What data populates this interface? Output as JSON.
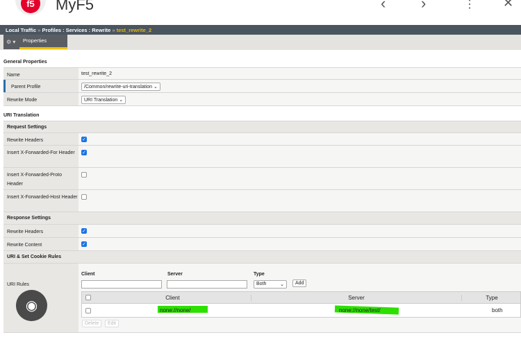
{
  "app": {
    "title": "MyF5",
    "logo": "f5"
  },
  "breadcrumb": {
    "a": "Local Traffic",
    "b": "Profiles : Services : Rewrite",
    "current": "test_rewrite_2",
    "sep": "»"
  },
  "tabs": {
    "properties": "Properties"
  },
  "general": {
    "title": "General Properties",
    "name_label": "Name",
    "name_value": "test_rewrite_2",
    "parent_label": "Parent Profile",
    "parent_value": "/Common/rewrite-uri-translation",
    "mode_label": "Rewrite Mode",
    "mode_value": "URI Translation"
  },
  "uri_translation": {
    "title": "URI Translation",
    "request": {
      "title": "Request Settings",
      "rewrite_headers": "Rewrite Headers",
      "xff": "Insert X-Forwarded-For Header",
      "xfp": "Insert X-Forwarded-Proto Header",
      "xfh": "Insert X-Forwarded-Host Header",
      "checked": [
        true,
        true,
        false,
        false
      ]
    },
    "response": {
      "title": "Response Settings",
      "rewrite_headers": "Rewrite Headers",
      "rewrite_content": "Rewrite Content",
      "checked": [
        true,
        true
      ]
    },
    "rules": {
      "title": "URI & Set Cookie Rules",
      "label": "URI Rules",
      "client_label": "Client",
      "server_label": "Server",
      "type_label": "Type",
      "type_value": "Both",
      "add": "Add",
      "columns": [
        "Client",
        "Server",
        "Type"
      ],
      "rows": [
        {
          "client": "none://none/",
          "server": "none://none/test/",
          "type": "both"
        }
      ],
      "delete": "Delete",
      "edit": "Edit"
    }
  }
}
